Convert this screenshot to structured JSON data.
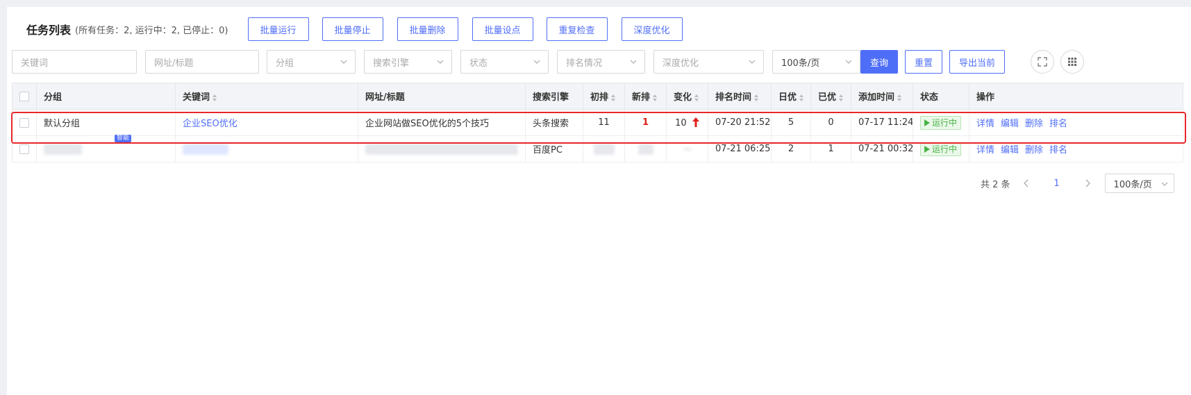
{
  "header": {
    "title": "任务列表",
    "subtitle": "(所有任务：2, 运行中：2, 已停止：0)",
    "buttons": [
      "批量运行",
      "批量停止",
      "批量删除",
      "批量设点",
      "重复检查",
      "深度优化"
    ]
  },
  "filters": {
    "keyword_placeholder": "关键词",
    "url_placeholder": "网址/标题",
    "group": "分组",
    "engine": "搜索引擎",
    "status": "状态",
    "ranking": "排名情况",
    "deep": "深度优化",
    "page_size": "100条/页",
    "query": "查询",
    "reset": "重置",
    "export": "导出当前"
  },
  "table": {
    "headers": [
      "分组",
      "关键词",
      "网址/标题",
      "搜索引擎",
      "初排",
      "新排",
      "变化",
      "排名时间",
      "日优",
      "已优",
      "添加时间",
      "状态",
      "操作"
    ],
    "rows": [
      {
        "group": "默认分组",
        "keyword": "企业SEO优化",
        "url": "企业网站做SEO优化的5个技巧",
        "engine": "头条搜索",
        "initial": "11",
        "new": "1",
        "change": "10",
        "rank_time": "07-20 21:52",
        "daily": "5",
        "done": "0",
        "added": "07-17 11:24",
        "status": "运行中"
      },
      {
        "group": "",
        "tag": "智能",
        "keyword": "",
        "url": "",
        "engine": "百度PC",
        "initial": "",
        "new": "",
        "change": "",
        "rank_time": "07-21 06:25",
        "daily": "2",
        "done": "1",
        "added": "07-21 00:32",
        "status": "运行中"
      }
    ],
    "ops": [
      "详情",
      "编辑",
      "删除",
      "排名"
    ]
  },
  "pagination": {
    "total": "共 2 条",
    "current": "1",
    "page_size": "100条/页"
  },
  "colors": {
    "accent": "#4f6ef7",
    "highlight": "#e8262a",
    "running": "#48b244"
  }
}
